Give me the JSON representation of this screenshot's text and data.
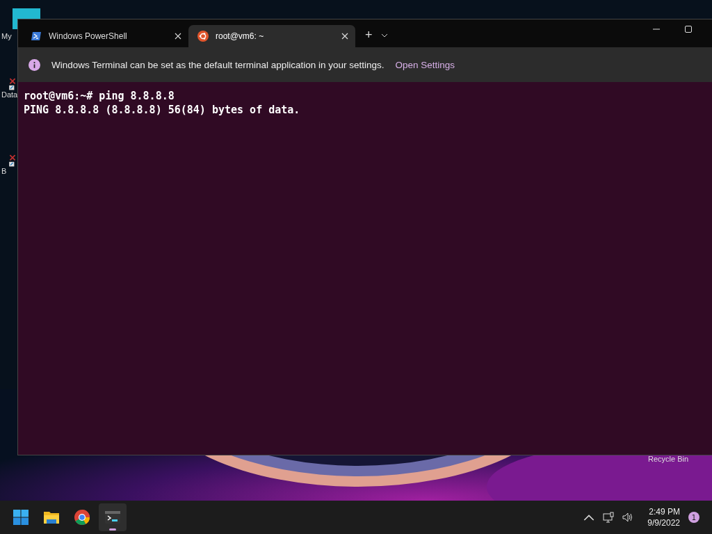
{
  "desktop": {
    "icons": [
      {
        "kind": "computer",
        "label": "My"
      },
      {
        "kind": "shortcut",
        "label": "Data"
      },
      {
        "kind": "shortcut",
        "label": "B"
      },
      {
        "kind": "text",
        "label": "Recycle Bin"
      }
    ]
  },
  "window": {
    "tabs": [
      {
        "kind": "powershell",
        "label": "Windows PowerShell",
        "selected": false
      },
      {
        "kind": "ubuntu",
        "label": "root@vm6: ~",
        "selected": true
      }
    ],
    "new_tab": "+",
    "infobar": {
      "message": "Windows Terminal can be set as the default terminal application in your settings.",
      "link": "Open Settings"
    },
    "terminal_lines": [
      "root@vm6:~# ping 8.8.8.8",
      "PING 8.8.8.8 (8.8.8.8) 56(84) bytes of data."
    ]
  },
  "taskbar": {
    "apps": [
      {
        "kind": "start",
        "selected": false
      },
      {
        "kind": "explorer",
        "selected": false
      },
      {
        "kind": "chrome",
        "selected": false
      },
      {
        "kind": "terminal",
        "selected": true
      }
    ],
    "time": "2:49 PM",
    "date": "9/9/2022",
    "notifications": "1"
  }
}
